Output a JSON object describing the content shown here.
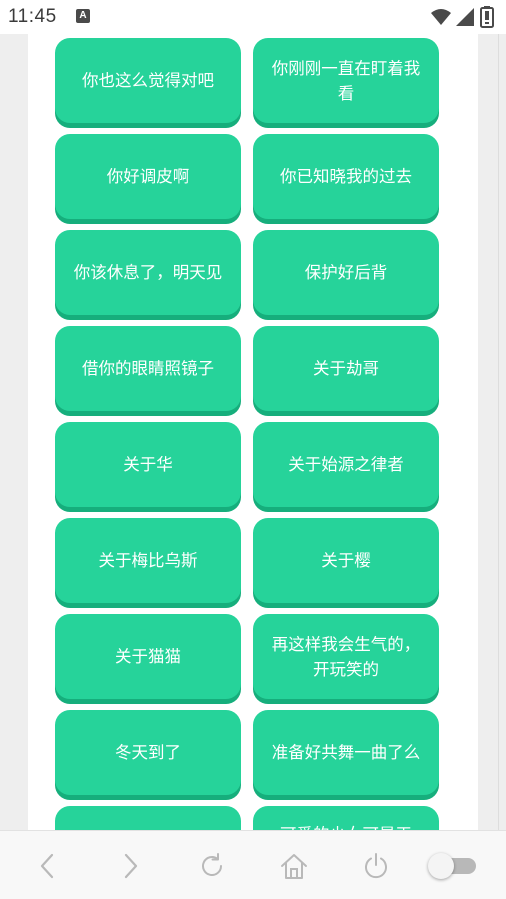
{
  "status_bar": {
    "time": "11:45",
    "notification_glyph": "A",
    "icons": [
      "wifi-icon",
      "signal-icon",
      "battery-icon"
    ]
  },
  "voice_buttons": [
    "你也这么觉得对吧",
    "你刚刚一直在盯着我看",
    "你好调皮啊",
    "你已知晓我的过去",
    "你该休息了，明天见",
    "保护好后背",
    "借你的眼睛照镜子",
    "关于劫哥",
    "关于华",
    "关于始源之律者",
    "关于梅比乌斯",
    "关于樱",
    "关于猫猫",
    "再这样我会生气的，开玩笑的",
    "冬天到了",
    "准备好共舞一曲了么",
    "",
    "可爱的少女可是天"
  ],
  "nav_bar": {
    "items": [
      "back-icon",
      "forward-icon",
      "refresh-icon",
      "home-icon",
      "power-icon",
      "toggle-switch"
    ]
  },
  "colors": {
    "button_bg": "#26d39a",
    "button_shadow": "#16ae7c",
    "button_text": "#ffffff"
  }
}
